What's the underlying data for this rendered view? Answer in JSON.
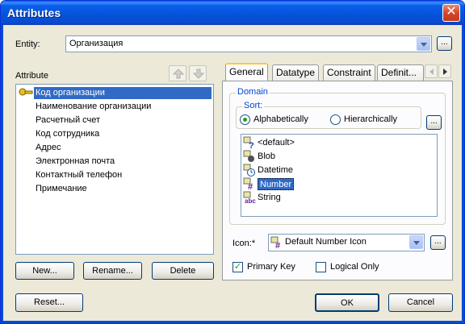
{
  "window": {
    "title": "Attributes",
    "close_glyph": "✕"
  },
  "entity": {
    "label": "Entity:",
    "value": "Организация",
    "browse_label": "..."
  },
  "attributes": {
    "label": "Attribute",
    "items": [
      {
        "label": "Код организации",
        "key": true,
        "selected": true
      },
      {
        "label": "Наименование организации"
      },
      {
        "label": "Расчетный счет"
      },
      {
        "label": "Код сотрудника"
      },
      {
        "label": "Адрес"
      },
      {
        "label": "Электронная почта"
      },
      {
        "label": "Контактный телефон"
      },
      {
        "label": "Примечание"
      }
    ],
    "buttons": {
      "new": "New...",
      "rename": "Rename...",
      "delete": "Delete"
    }
  },
  "tabs": [
    {
      "label": "General",
      "active": true
    },
    {
      "label": "Datatype"
    },
    {
      "label": "Constraint"
    },
    {
      "label": "Definit..."
    }
  ],
  "domain": {
    "group_label": "Domain",
    "sort_label": "Sort:",
    "sort_options": [
      {
        "label": "Alphabetically",
        "selected": true
      },
      {
        "label": "Hierarchically",
        "selected": false
      }
    ],
    "browse_label": "...",
    "items": [
      {
        "label": "<default>",
        "icon": "question-icon"
      },
      {
        "label": "Blob",
        "icon": "blob-icon"
      },
      {
        "label": "Datetime",
        "icon": "clock-icon"
      },
      {
        "label": "Number",
        "icon": "hash-icon",
        "selected": true
      },
      {
        "label": "String",
        "icon": "abc-icon"
      }
    ]
  },
  "icon_field": {
    "label": "Icon:*",
    "value": "Default Number Icon",
    "browse_label": "..."
  },
  "checkboxes": {
    "primary_key": {
      "label": "Primary Key",
      "checked": true
    },
    "logical_only": {
      "label": "Logical Only",
      "checked": false
    }
  },
  "footer": {
    "reset": "Reset...",
    "ok": "OK",
    "cancel": "Cancel"
  }
}
